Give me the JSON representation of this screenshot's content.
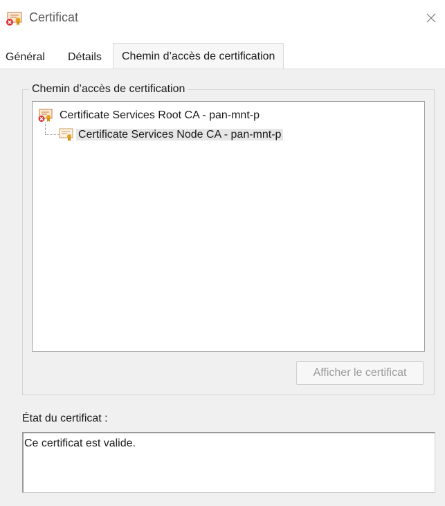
{
  "window": {
    "title": "Certificat",
    "icons": {
      "title": "certificate-error-icon",
      "close": "close-icon"
    }
  },
  "tabs": [
    {
      "label": "Général",
      "active": false
    },
    {
      "label": "Détails",
      "active": false
    },
    {
      "label": "Chemin d’accès de certification",
      "active": true
    }
  ],
  "path_group": {
    "legend": "Chemin d’accès de certification",
    "items": [
      {
        "label": "Certificate Services Root CA - pan-mnt-p",
        "icon": "certificate-error-icon",
        "selected": false
      },
      {
        "label": "Certificate Services Node CA - pan-mnt-p",
        "icon": "certificate-icon",
        "selected": true
      }
    ],
    "view_button": "Afficher le certificat"
  },
  "status": {
    "label": "État du certificat :",
    "text": "Ce certificat est valide."
  },
  "colors": {
    "background": "#f0f0f0",
    "selection": "#e6e6e6",
    "cert_seal": "#e2a21b",
    "error_badge": "#d62f2f"
  }
}
